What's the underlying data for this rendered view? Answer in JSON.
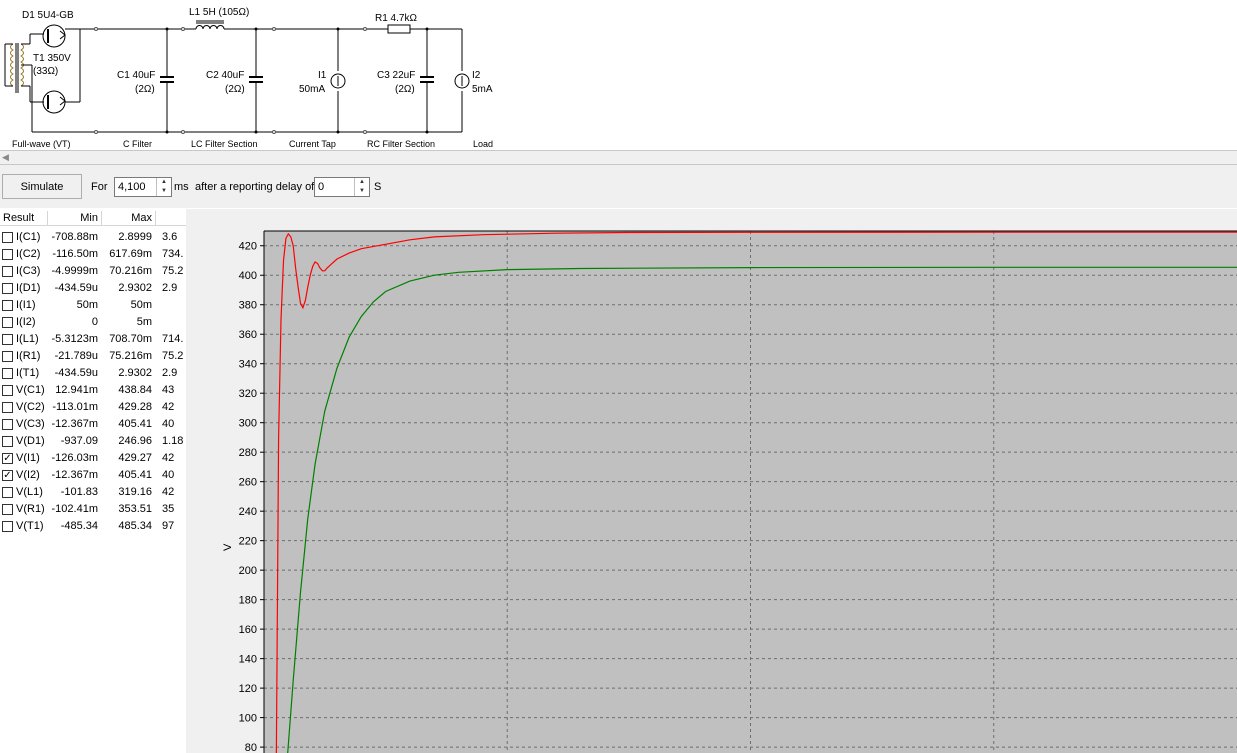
{
  "schematic": {
    "components": {
      "d1": "D1 5U4-GB",
      "t1_name": "T1 350V",
      "t1_res": "(33Ω)",
      "l1": "L1 5H (105Ω)",
      "r1": "R1 4.7kΩ",
      "c1_name": "C1 40uF",
      "c1_esr": "(2Ω)",
      "c2_name": "C2 40uF",
      "c2_esr": "(2Ω)",
      "i1_name": "I1",
      "i1_val": "50mA",
      "c3_name": "C3 22uF",
      "c3_esr": "(2Ω)",
      "i2_name": "I2",
      "i2_val": "5mA"
    },
    "sections": [
      "Full-wave (VT)",
      "C Filter",
      "LC Filter Section",
      "Current Tap",
      "RC Filter Section",
      "Load"
    ]
  },
  "toolbar": {
    "simulate_label": "Simulate",
    "for_label": "For",
    "duration_value": "4,100",
    "ms_label": "ms",
    "delay_label": "after a reporting delay of",
    "delay_value": "0",
    "s_label": "S"
  },
  "results": {
    "headers": [
      "Result",
      "Min",
      "Max"
    ],
    "rows": [
      {
        "name": "I(C1)",
        "min": "-708.88m",
        "max": "2.8999",
        "extra": "3.6",
        "checked": false
      },
      {
        "name": "I(C2)",
        "min": "-116.50m",
        "max": "617.69m",
        "extra": "734.",
        "checked": false
      },
      {
        "name": "I(C3)",
        "min": "-4.9999m",
        "max": "70.216m",
        "extra": "75.2",
        "checked": false
      },
      {
        "name": "I(D1)",
        "min": "-434.59u",
        "max": "2.9302",
        "extra": "2.9",
        "checked": false
      },
      {
        "name": "I(I1)",
        "min": "50m",
        "max": "50m",
        "extra": "",
        "checked": false
      },
      {
        "name": "I(I2)",
        "min": "0",
        "max": "5m",
        "extra": "",
        "checked": false
      },
      {
        "name": "I(L1)",
        "min": "-5.3123m",
        "max": "708.70m",
        "extra": "714.",
        "checked": false
      },
      {
        "name": "I(R1)",
        "min": "-21.789u",
        "max": "75.216m",
        "extra": "75.2",
        "checked": false
      },
      {
        "name": "I(T1)",
        "min": "-434.59u",
        "max": "2.9302",
        "extra": "2.9",
        "checked": false
      },
      {
        "name": "V(C1)",
        "min": "12.941m",
        "max": "438.84",
        "extra": "43",
        "checked": false
      },
      {
        "name": "V(C2)",
        "min": "-113.01m",
        "max": "429.28",
        "extra": "42",
        "checked": false
      },
      {
        "name": "V(C3)",
        "min": "-12.367m",
        "max": "405.41",
        "extra": "40",
        "checked": false
      },
      {
        "name": "V(D1)",
        "min": "-937.09",
        "max": "246.96",
        "extra": "1.18",
        "checked": false
      },
      {
        "name": "V(I1)",
        "min": "-126.03m",
        "max": "429.27",
        "extra": "42",
        "checked": true
      },
      {
        "name": "V(I2)",
        "min": "-12.367m",
        "max": "405.41",
        "extra": "40",
        "checked": true
      },
      {
        "name": "V(L1)",
        "min": "-101.83",
        "max": "319.16",
        "extra": "42",
        "checked": false
      },
      {
        "name": "V(R1)",
        "min": "-102.41m",
        "max": "353.51",
        "extra": "35",
        "checked": false
      },
      {
        "name": "V(T1)",
        "min": "-485.34",
        "max": "485.34",
        "extra": "97",
        "checked": false
      }
    ]
  },
  "chart_data": {
    "type": "line",
    "ylabel": "V",
    "xlabel": "",
    "ylim": [
      76,
      430
    ],
    "yticks": [
      80,
      100,
      120,
      140,
      160,
      180,
      200,
      220,
      240,
      260,
      280,
      300,
      320,
      340,
      360,
      380,
      400,
      420
    ],
    "xlim": [
      0,
      400
    ],
    "grid": true,
    "background": "#c0c0c0",
    "series": [
      {
        "color": "#ff0000",
        "points": [
          [
            5,
            60
          ],
          [
            6,
            290
          ],
          [
            7,
            370
          ],
          [
            8,
            410
          ],
          [
            9,
            425
          ],
          [
            10,
            428
          ],
          [
            11,
            426
          ],
          [
            12,
            420
          ],
          [
            13,
            405
          ],
          [
            14,
            392
          ],
          [
            15,
            381
          ],
          [
            16,
            378
          ],
          [
            17,
            383
          ],
          [
            18,
            392
          ],
          [
            19,
            400
          ],
          [
            20,
            406
          ],
          [
            21,
            409
          ],
          [
            22,
            408
          ],
          [
            23,
            405
          ],
          [
            24,
            403
          ],
          [
            25,
            403
          ],
          [
            26,
            405
          ],
          [
            28,
            408
          ],
          [
            30,
            411
          ],
          [
            35,
            415
          ],
          [
            40,
            418
          ],
          [
            50,
            421
          ],
          [
            60,
            424
          ],
          [
            70,
            426
          ],
          [
            90,
            427.5
          ],
          [
            120,
            428.5
          ],
          [
            150,
            429
          ],
          [
            200,
            429.1
          ],
          [
            300,
            429.2
          ],
          [
            400,
            429.2
          ]
        ]
      },
      {
        "color": "#008000",
        "points": [
          [
            9,
            60
          ],
          [
            12,
            125
          ],
          [
            15,
            185
          ],
          [
            18,
            235
          ],
          [
            21,
            272
          ],
          [
            25,
            308
          ],
          [
            30,
            337
          ],
          [
            35,
            358
          ],
          [
            40,
            372
          ],
          [
            45,
            382
          ],
          [
            50,
            389
          ],
          [
            60,
            396
          ],
          [
            70,
            400
          ],
          [
            80,
            402
          ],
          [
            100,
            403.8
          ],
          [
            130,
            404.6
          ],
          [
            200,
            405.2
          ],
          [
            300,
            405.4
          ],
          [
            400,
            405.4
          ]
        ]
      }
    ]
  }
}
